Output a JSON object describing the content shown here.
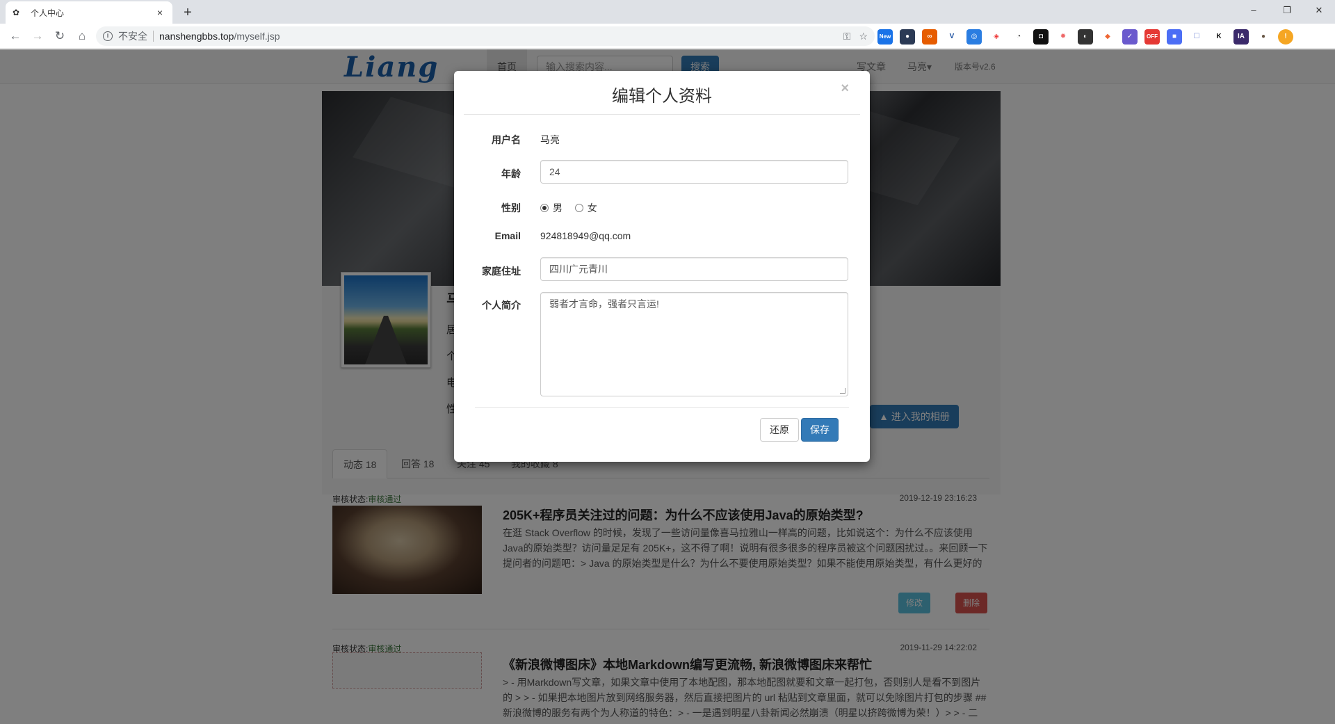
{
  "browser": {
    "tab_title": "个人中心",
    "tab_close": "×",
    "new_tab": "+",
    "insecure_label": "不安全",
    "url_host": "nanshengbbs.top",
    "url_path": "/myself.jsp",
    "win_minimize": "–",
    "win_restore": "❐",
    "win_close": "✕",
    "extension_badges": [
      "New",
      "OFF"
    ]
  },
  "site_nav": {
    "logo": "Liang",
    "home": "首页",
    "search_placeholder": "输入搜索内容...",
    "search_button": "搜索",
    "write": "写文章",
    "user": "马亮▾",
    "version": "版本号v2.6"
  },
  "profile": {
    "side_letters": [
      "马",
      "居",
      "个",
      "电",
      "性"
    ],
    "album_button": "进入我的相册"
  },
  "tabs": [
    "动态 18",
    "回答 18",
    "关注 45",
    "我的收藏 8"
  ],
  "posts": [
    {
      "audit_label": "审核状态:",
      "audit_value": "审核通过",
      "date": "2019-12-19 23:16:23",
      "title": "205K+程序员关注过的问题：为什么不应该使用Java的原始类型?",
      "excerpt": "在逛 Stack Overflow 的时候，发现了一些访问量像喜马拉雅山一样高的问题，比如说这个：为什么不应该使用Java的原始类型？访问量足足有 205K+，这不得了啊！说明有很多很多的程序员被这个问题困扰过。。来回顾一下提问者的问题吧：> Java 的原始类型是什么？为什么不要使用原始类型？如果不能使用原始类型，有什么更好的选...",
      "edit": "修改",
      "delete": "删除"
    },
    {
      "audit_label": "审核状态:",
      "audit_value": "审核通过",
      "date": "2019-11-29 14:22:02",
      "title": "《新浪微博图床》本地Markdown编写更流畅, 新浪微博图床来帮忙",
      "excerpt": "> - 用Markdown写文章，如果文章中使用了本地配图，那本地配图就要和文章一起打包，否则别人是看不到图片的 > > - 如果把本地图片放到网络服务器，然后直接把图片的 url 粘贴到文章里面，就可以免除图片打包的步骤 ## 新浪微博的服务有两个为人称道的特色：> - 一是遇到明星八卦新闻必然崩溃（明星以挤跨微博为荣！）> > - 二是..."
    }
  ],
  "modal": {
    "title": "编辑个人资料",
    "close": "×",
    "username_label": "用户名",
    "username_value": "马亮",
    "age_label": "年龄",
    "age_value": "24",
    "gender_label": "性别",
    "gender_male": "男",
    "gender_female": "女",
    "gender_selected": "男",
    "email_label": "Email",
    "email_value": "924818949@qq.com",
    "address_label": "家庭住址",
    "address_value": "四川广元青川",
    "bio_label": "个人简介",
    "bio_value": "弱者才言命，强者只言运!",
    "reset_button": "还原",
    "save_button": "保存"
  },
  "colors": {
    "primary": "#337ab7",
    "info": "#5bc0de",
    "danger": "#d9534f",
    "success_text": "#3c763d"
  }
}
